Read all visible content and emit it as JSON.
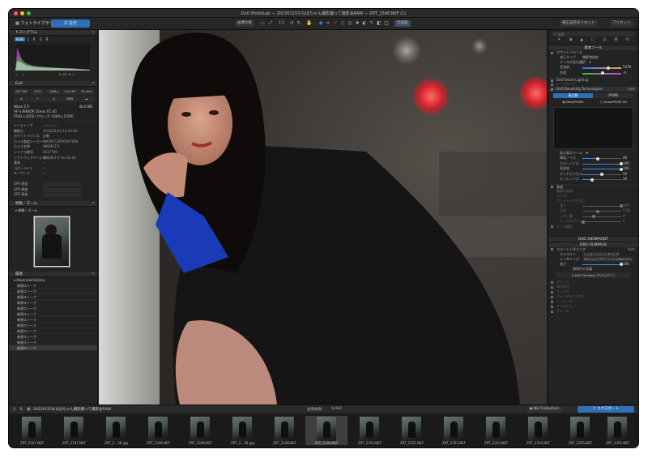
{
  "window": {
    "title": "DxO PhotoLab — 20230115ななほちゃん撮影撮って撮影会RAW — Z9T_2348.NEF (1)",
    "colors": {
      "accent": "#2f6fb5",
      "bg": "#1f1f1f"
    }
  },
  "toolbar": {
    "tab_library": "フォトライブラリ",
    "tab_customize": "設定",
    "compare_label": "画像比較",
    "zoom_label": "1:1",
    "fullscreen_label": "全画面",
    "reset_label": "補正設定のリセット",
    "preset_label": "プリセット"
  },
  "left": {
    "histogram_title": "ヒストグラム",
    "histogram_channels": [
      "RGB",
      "L",
      "R",
      "G",
      "B"
    ],
    "histogram_readout": "R: 8G: B: L:",
    "exif_title": "Exif",
    "exif_values": [
      "ISO 100",
      "f/2.8",
      "1/80 s",
      "+0.0 EV",
      "35 mm"
    ],
    "exif_buttons": [
      "A",
      "",
      "",
      "RAW",
      ""
    ],
    "camera": "Nikon Z 9",
    "filesize": "48.6 MB",
    "lens": "AF-S NIKKOR 35mm f/1.4G",
    "dims": "5504 x 8256 (クロップ: 4340 x 5709)",
    "meta_rows": [
      {
        "k": "レーティング",
        "v": "☆☆☆☆☆"
      },
      {
        "k": "撮影日",
        "v": "2023/01/15 14:18:00"
      },
      {
        "k": "ホワイトバランス",
        "v": "自動"
      },
      {
        "k": "カメラ製造メーカー",
        "v": "NIKON CORPORATION"
      },
      {
        "k": "カメラ名称",
        "v": "NIKON Z 9"
      },
      {
        "k": "シリアル番号",
        "v": "3517799"
      },
      {
        "k": "ソフトウェアバージョン",
        "v": "NIKON Z 9 Ver.03.00"
      },
      {
        "k": "著者",
        "v": "--"
      },
      {
        "k": "コピーライト",
        "v": "--"
      },
      {
        "k": "キーワード",
        "v": "--"
      }
    ],
    "gps_rows": [
      "GPS 経度",
      "GPS 緯度",
      "GPS 高度"
    ],
    "move_zoom_title": "移動／ズーム",
    "move_zoom_label": "移動／ズーム",
    "history_title": "履歴",
    "history_group": "Advanced History",
    "history_items": [
      "新規ストーク",
      "新規ストーク",
      "新規ストーク",
      "新規ストーク",
      "新規ストーク",
      "新規ストーク",
      "新規ストーク",
      "新規ストーク",
      "新規ストーク",
      "新規ストーク",
      "新規ストーク",
      "新規ストーク"
    ]
  },
  "right": {
    "search_placeholder": "検索",
    "basic_tools_title": "基本ツール",
    "wb_label": "ホワイトバランス",
    "wb_type": "撮影時設定",
    "picker_label": "ツールの色を選択",
    "temp_label": "色温度",
    "temp_value": "5470",
    "tint_label": "色相",
    "tint_value": "-4",
    "smartlighting_label": "DxO Smart Lighting",
    "tone_label": "トーンカーブ",
    "denoise_label": "DxO Denoising Technologies",
    "denoise_auto": "Auto",
    "hq_label": "高品質",
    "prime_label": "PRIME",
    "deepprime": "DeepPRIME",
    "deepprime_xd": "DeepPRIME XD",
    "preview_label": "拡大表示ツール",
    "noise_sliders": [
      {
        "label": "輝度ノイズ",
        "value": "40",
        "frac": 0.4
      },
      {
        "label": "カラーノイズ",
        "value": "100",
        "frac": 1.0
      },
      {
        "label": "低周波",
        "value": "100",
        "frac": 1.0
      },
      {
        "label": "デッドピクセル",
        "value": "50",
        "frac": 0.5
      },
      {
        "label": "モイレノイズ",
        "value": "26",
        "frac": 0.26
      }
    ],
    "detail_label": "表現",
    "detail_rows": [
      "輪郭の強調",
      "ガンマ",
      "アンシャープマスク"
    ],
    "detail_sliders": [
      {
        "label": "強さ",
        "value": "100",
        "frac": 1.0
      },
      {
        "label": "半径",
        "value": "0.50",
        "frac": 0.4
      },
      {
        "label": "しきい値",
        "value": "4",
        "frac": 0.3
      },
      {
        "label": "エッジのアウト",
        "value": "0",
        "frac": 0.0
      }
    ],
    "lens_sharp_label": "レンズ補正",
    "viewpoint_title": "DXO VIEWPOINT",
    "filmpack_title": "DXO FILMPACK",
    "color_rendering": "カラーレンダリング",
    "category_label": "カテゴリー",
    "category_value": "ジェネリックレンダリング",
    "rendering_label": "レンダリング",
    "rendering_value": "DxO カメラプロファイル (Nikon Z 9)",
    "strength_label": "強さ",
    "strength_value": "100",
    "protect_label": "飽和色の保護",
    "filmpack_time": "DxO FilmPack タイムマシン",
    "more_modules": [
      "グレイン",
      "周辺減光",
      "フィルタ",
      "チャンネルミキサー",
      "トーニング",
      "テクスチャ",
      "フレーム"
    ]
  },
  "filmstrip": {
    "folder": "20230115ななほちゃん撮影撮って撮影会RAW",
    "count_label": "画像枚数：",
    "count_value": "1/482",
    "nik_label": "Nik Collection",
    "export_label": "エクスポート",
    "thumbs": [
      "Z9T_2347.NEF",
      "Z9T_2347.NEF",
      "Z9T_2...36.jpg",
      "Z9T_2346.NEF",
      "Z9T_2348.NEF",
      "Z9T_2...36.jpg",
      "Z9T_2348.NEF",
      "Z9T_2349.NEF",
      "Z9T_2350.NEF",
      "Z9T_2351.NEF",
      "Z9T_2352.NEF",
      "Z9T_2353.NEF",
      "Z9T_2354.NEF",
      "Z9T_2355.NEF",
      "Z9T_2356.NEF"
    ]
  }
}
